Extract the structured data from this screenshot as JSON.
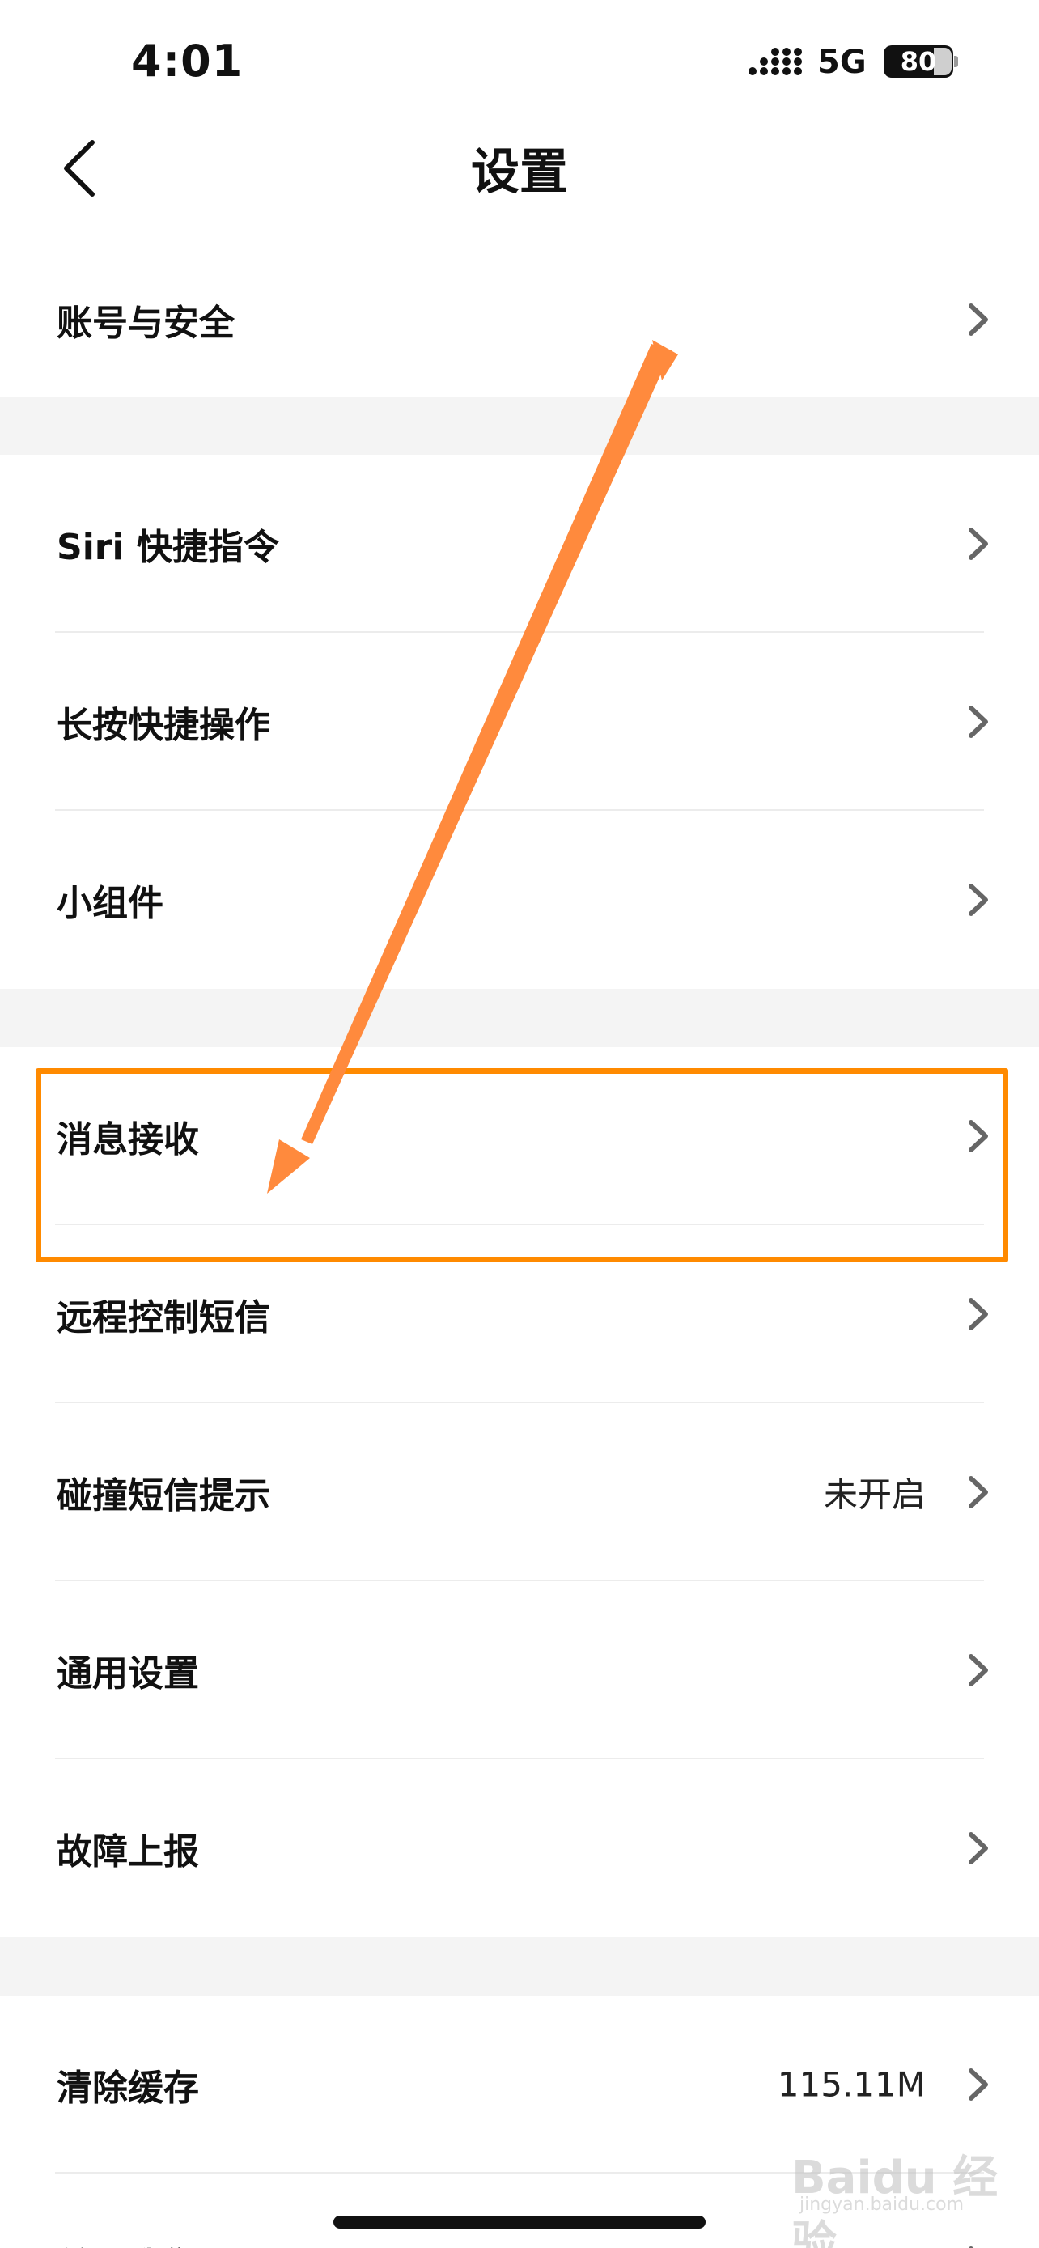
{
  "status_bar": {
    "time": "4:01",
    "network": "5G",
    "battery": "80"
  },
  "nav": {
    "title": "设置"
  },
  "settings": {
    "group1": [
      {
        "label": "账号与安全",
        "value": ""
      }
    ],
    "group2": [
      {
        "label": "Siri 快捷指令",
        "value": ""
      },
      {
        "label": "长按快捷操作",
        "value": ""
      },
      {
        "label": "小组件",
        "value": ""
      }
    ],
    "group3": [
      {
        "label": "消息接收",
        "value": ""
      },
      {
        "label": "远程控制短信",
        "value": ""
      },
      {
        "label": "碰撞短信提示",
        "value": "未开启"
      },
      {
        "label": "通用设置",
        "value": ""
      },
      {
        "label": "故障上报",
        "value": ""
      }
    ],
    "group4": [
      {
        "label": "清除缓存",
        "value": "115.11M"
      },
      {
        "label": "关于我们",
        "value": ""
      }
    ]
  },
  "annotation": {
    "highlight_color": "#ff8a00",
    "arrow_color": "#ff8a3d"
  },
  "watermark": {
    "brand": "Baidu 经验",
    "url": "jingyan.baidu.com"
  }
}
